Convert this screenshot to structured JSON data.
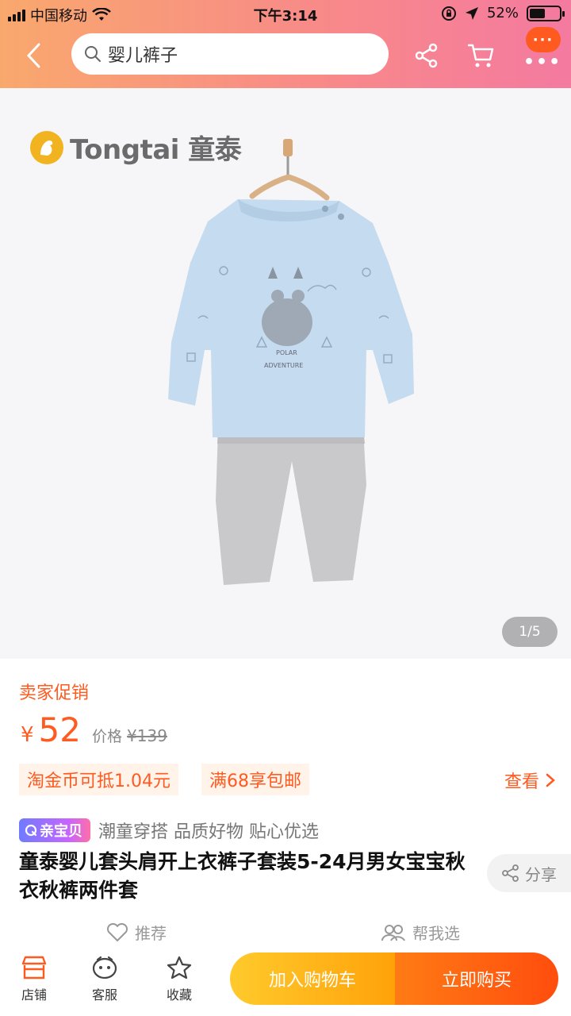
{
  "status_bar": {
    "carrier": "中国移动",
    "time": "下午3:14",
    "battery_percent": "52%",
    "battery_level": 0.52
  },
  "header": {
    "search_text": "婴儿裤子"
  },
  "gallery": {
    "logo_text": "Tongtai 童泰",
    "page_indicator": "1/5"
  },
  "price": {
    "promo_label": "卖家促销",
    "currency": "¥",
    "value": "52",
    "original_label": "价格",
    "original_price": "¥139"
  },
  "coupons": {
    "coupon_1": "淘金币可抵1.04元",
    "coupon_2": "满68享包邮",
    "view_more": "查看"
  },
  "tags": {
    "badge": "亲宝贝",
    "text": "潮童穿搭 品质好物 贴心优选"
  },
  "product": {
    "title": "童泰婴儿套头肩开上衣裤子套装5-24月男女宝宝秋衣秋裤两件套",
    "share_label": "分享"
  },
  "sub_actions": {
    "recommend": "推荐",
    "help_choose": "帮我选"
  },
  "bottom_bar": {
    "shop": "店铺",
    "service": "客服",
    "favorite": "收藏",
    "add_to_cart": "加入购物车",
    "buy_now": "立即购买"
  },
  "colors": {
    "accent": "#ff5a1f",
    "header_start": "#f9a86d",
    "header_end": "#f47aa0",
    "cart_button": "#ffa20a",
    "buy_button": "#ff4d0e"
  }
}
